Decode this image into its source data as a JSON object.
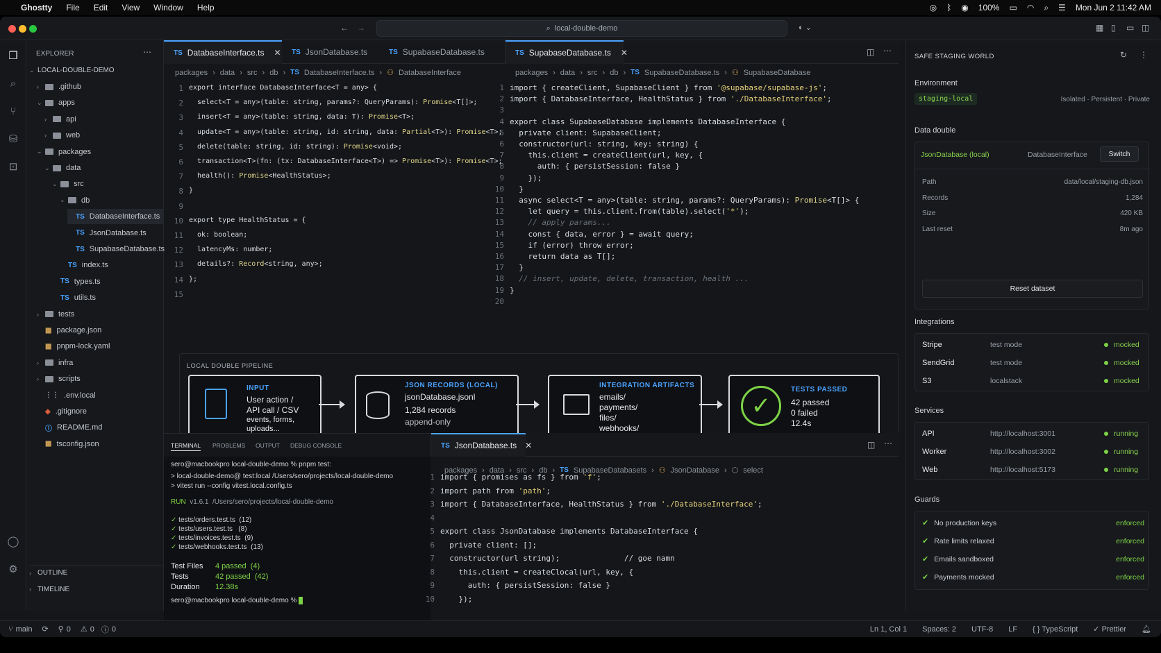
{
  "menubar": {
    "app": "Ghostty",
    "items": [
      "File",
      "Edit",
      "View",
      "Window",
      "Help"
    ],
    "battery": "100%",
    "datetime": "Mon Jun 2  11:42 AM"
  },
  "window": {
    "search": "local-double-demo"
  },
  "explorer": {
    "title": "EXPLORER",
    "root": "LOCAL-DOUBLE-DEMO",
    "items": [
      {
        "label": ".github",
        "kind": "folder",
        "depth": 1,
        "open": false
      },
      {
        "label": "apps",
        "kind": "folder",
        "depth": 1,
        "open": true
      },
      {
        "label": "api",
        "kind": "folder",
        "depth": 2,
        "open": false
      },
      {
        "label": "web",
        "kind": "folder",
        "depth": 2,
        "open": false
      },
      {
        "label": "packages",
        "kind": "folder",
        "depth": 1,
        "open": true
      },
      {
        "label": "data",
        "kind": "folder",
        "depth": 2,
        "open": true
      },
      {
        "label": "src",
        "kind": "folder",
        "depth": 3,
        "open": true
      },
      {
        "label": "db",
        "kind": "folder",
        "depth": 4,
        "open": true
      },
      {
        "label": "DatabaseInterface.ts",
        "kind": "ts",
        "depth": 5,
        "selected": true
      },
      {
        "label": "JsonDatabase.ts",
        "kind": "ts",
        "depth": 5
      },
      {
        "label": "SupabaseDatabase.ts",
        "kind": "ts",
        "depth": 5
      },
      {
        "label": "index.ts",
        "kind": "ts",
        "depth": 4
      },
      {
        "label": "types.ts",
        "kind": "ts",
        "depth": 3
      },
      {
        "label": "utils.ts",
        "kind": "ts",
        "depth": 3
      },
      {
        "label": "tests",
        "kind": "folder",
        "depth": 1,
        "open": false
      },
      {
        "label": "package.json",
        "kind": "json",
        "depth": 1
      },
      {
        "label": "pnpm-lock.yaml",
        "kind": "json",
        "depth": 1
      },
      {
        "label": "infra",
        "kind": "folder",
        "depth": 1,
        "open": false
      },
      {
        "label": "scripts",
        "kind": "folder",
        "depth": 1,
        "open": false
      },
      {
        "label": ".env.local",
        "kind": "env",
        "depth": 1
      },
      {
        "label": ".gitignore",
        "kind": "git",
        "depth": 1
      },
      {
        "label": "README.md",
        "kind": "info",
        "depth": 1
      },
      {
        "label": "tsconfig.json",
        "kind": "json",
        "depth": 1
      }
    ],
    "outline": "OUTLINE",
    "timeline": "TIMELINE"
  },
  "editor1": {
    "tabs": [
      "DatabaseInterface.ts",
      "JsonDatabase.ts",
      "SupabaseDatabase.ts"
    ],
    "crumbs": [
      "packages",
      "data",
      "src",
      "db",
      "DatabaseInterface.ts",
      "DatabaseInterface"
    ],
    "lines": [
      "export interface DatabaseInterface<T = any> {",
      "  select<T = any>(table: string, params?: QueryParams): Promise<T[]>;",
      "  insert<T = any>(table: string, data: T): Promise<T>;",
      "  update<T = any>(table: string, id: string, data: Partial<T>): Promise<T>;",
      "  delete(table: string, id: string): Promise<void>;",
      "  transaction<T>(fn: (tx: DatabaseInterface<T>) => Promise<T>): Promise<T>;",
      "  health(): Promise<HealthStatus>;",
      "}",
      "",
      "export type HealthStatus = {",
      "  ok: boolean;",
      "  latencyMs: number;",
      "  details?: Record<string, any>;",
      "};",
      ""
    ]
  },
  "editor2": {
    "tab": "SupabaseDatabase.ts",
    "crumbs": [
      "packages",
      "data",
      "src",
      "db",
      "SupabaseDatabase.ts",
      "SupabaseDatabase"
    ],
    "lines": [
      "import { createClient, SupabaseClient } from '@supabase/supabase-js';",
      "import { DatabaseInterface, HealthStatus } from './DatabaseInterface';",
      "",
      "export class SupabaseDatabase implements DatabaseInterface {",
      "  private client: SupabaseClient;",
      "  constructor(url: string, key: string) {",
      "    this.client = createClient(url, key, {",
      "      auth: { persistSession: false }",
      "    });",
      "  }",
      "  async select<T = any>(table: string, params?: QueryParams): Promise<T[]> {",
      "    let query = this.client.from(table).select('*');",
      "    // apply params...",
      "    const { data, error } = await query;",
      "    if (error) throw error;",
      "    return data as T[];",
      "  }",
      "  // insert, update, delete, transaction, health ...",
      "}",
      ""
    ]
  },
  "pipeline": {
    "title": "LOCAL DOUBLE PIPELINE",
    "stages": [
      {
        "head": "INPUT",
        "lines": [
          "User action /",
          "API call / CSV",
          "events, forms,",
          "uploads..."
        ]
      },
      {
        "head": "JSON RECORDS (LOCAL)",
        "lines": [
          "jsonDatabase.jsonl",
          "1,284 records",
          "append-only"
        ]
      },
      {
        "head": "INTEGRATION ARTIFACTS",
        "lines": [
          "emails/",
          "payments/",
          "files/",
          "webhooks/"
        ]
      },
      {
        "head": "TESTS PASSED",
        "lines": [
          "42 passed",
          "0 failed",
          "12.4s"
        ]
      }
    ]
  },
  "panel": {
    "tabs": [
      "TERMINAL",
      "PROBLEMS",
      "OUTPUT",
      "DEBUG CONSOLE"
    ],
    "prompt1": "sero@macbookpro local-double-demo % pnpm test:",
    "cmd1": "> local-double-demo@ test:local /Users/sero/projects/local-double-demo",
    "cmd2": "> vitest run --config vitest.local.config.ts",
    "run": "RUN",
    "runinfo": "v1.6.1  /Users/sero/projects/local-double-demo",
    "files": [
      "tests/orders.test.ts  (12)",
      "tests/users.test.ts   (8)",
      "tests/invoices.test.ts  (9)",
      "tests/webhooks.test.ts  (13)"
    ],
    "summary": [
      {
        "k": "Test Files",
        "v": "4 passed  (4)"
      },
      {
        "k": "Tests",
        "v": "42 passed  (42)"
      },
      {
        "k": "Duration",
        "v": "12.38s"
      }
    ],
    "prompt2": "sero@macbookpro local-double-demo %"
  },
  "editor3": {
    "tab": "JsonDatabase.ts",
    "crumbs": [
      "packages",
      "data",
      "src",
      "db",
      "SupabaseDatabasets",
      "JsonDatabase",
      "select"
    ],
    "lines": [
      "import { promises as fs } from 'f';",
      "import path from 'path';",
      "import { DatabaseInterface, HealthStatus } from './DatabaseInterface';",
      "",
      "export class JsonDatabase implements DatabaseInterface {",
      "  private client: [];",
      "  constructor(url string);              // goe namn",
      "    this.client = createClocal(url, key, {",
      "      auth: { persistSession: false }",
      "    });"
    ]
  },
  "right": {
    "title": "SAFE STAGING WORLD",
    "env_label": "Environment",
    "env": "staging-local",
    "env_tags": "Isolated · Persistent · Private",
    "dd_label": "Data double",
    "dd_name": "JsonDatabase (local)",
    "dd_iface": "DatabaseInterface",
    "dd_switch": "Switch",
    "props": [
      {
        "k": "Path",
        "v": "data/local/staging-db.json"
      },
      {
        "k": "Records",
        "v": "1,284"
      },
      {
        "k": "Size",
        "v": "420 KB"
      },
      {
        "k": "Last reset",
        "v": "8m ago"
      }
    ],
    "reset": "Reset dataset",
    "int_label": "Integrations",
    "integrations": [
      {
        "n": "Stripe",
        "m": "test mode",
        "s": "mocked"
      },
      {
        "n": "SendGrid",
        "m": "test mode",
        "s": "mocked"
      },
      {
        "n": "S3",
        "m": "localstack",
        "s": "mocked"
      }
    ],
    "svc_label": "Services",
    "services": [
      {
        "n": "API",
        "u": "http://localhost:3001",
        "s": "running"
      },
      {
        "n": "Worker",
        "u": "http://localhost:3002",
        "s": "running"
      },
      {
        "n": "Web",
        "u": "http://localhost:5173",
        "s": "running"
      }
    ],
    "guard_label": "Guards",
    "guards": [
      {
        "n": "No production keys",
        "s": "enforced"
      },
      {
        "n": "Rate limits relaxed",
        "s": "enforced"
      },
      {
        "n": "Emails sandboxed",
        "s": "enforced"
      },
      {
        "n": "Payments mocked",
        "s": "enforced"
      }
    ]
  },
  "status": {
    "branch": "main",
    "ports": "0",
    "warnings": "0",
    "errors": "0",
    "pos": "Ln 1, Col 1",
    "spaces": "Spaces: 2",
    "enc": "UTF-8",
    "eol": "LF",
    "lang": "TypeScript",
    "fmt": "Prettier"
  }
}
